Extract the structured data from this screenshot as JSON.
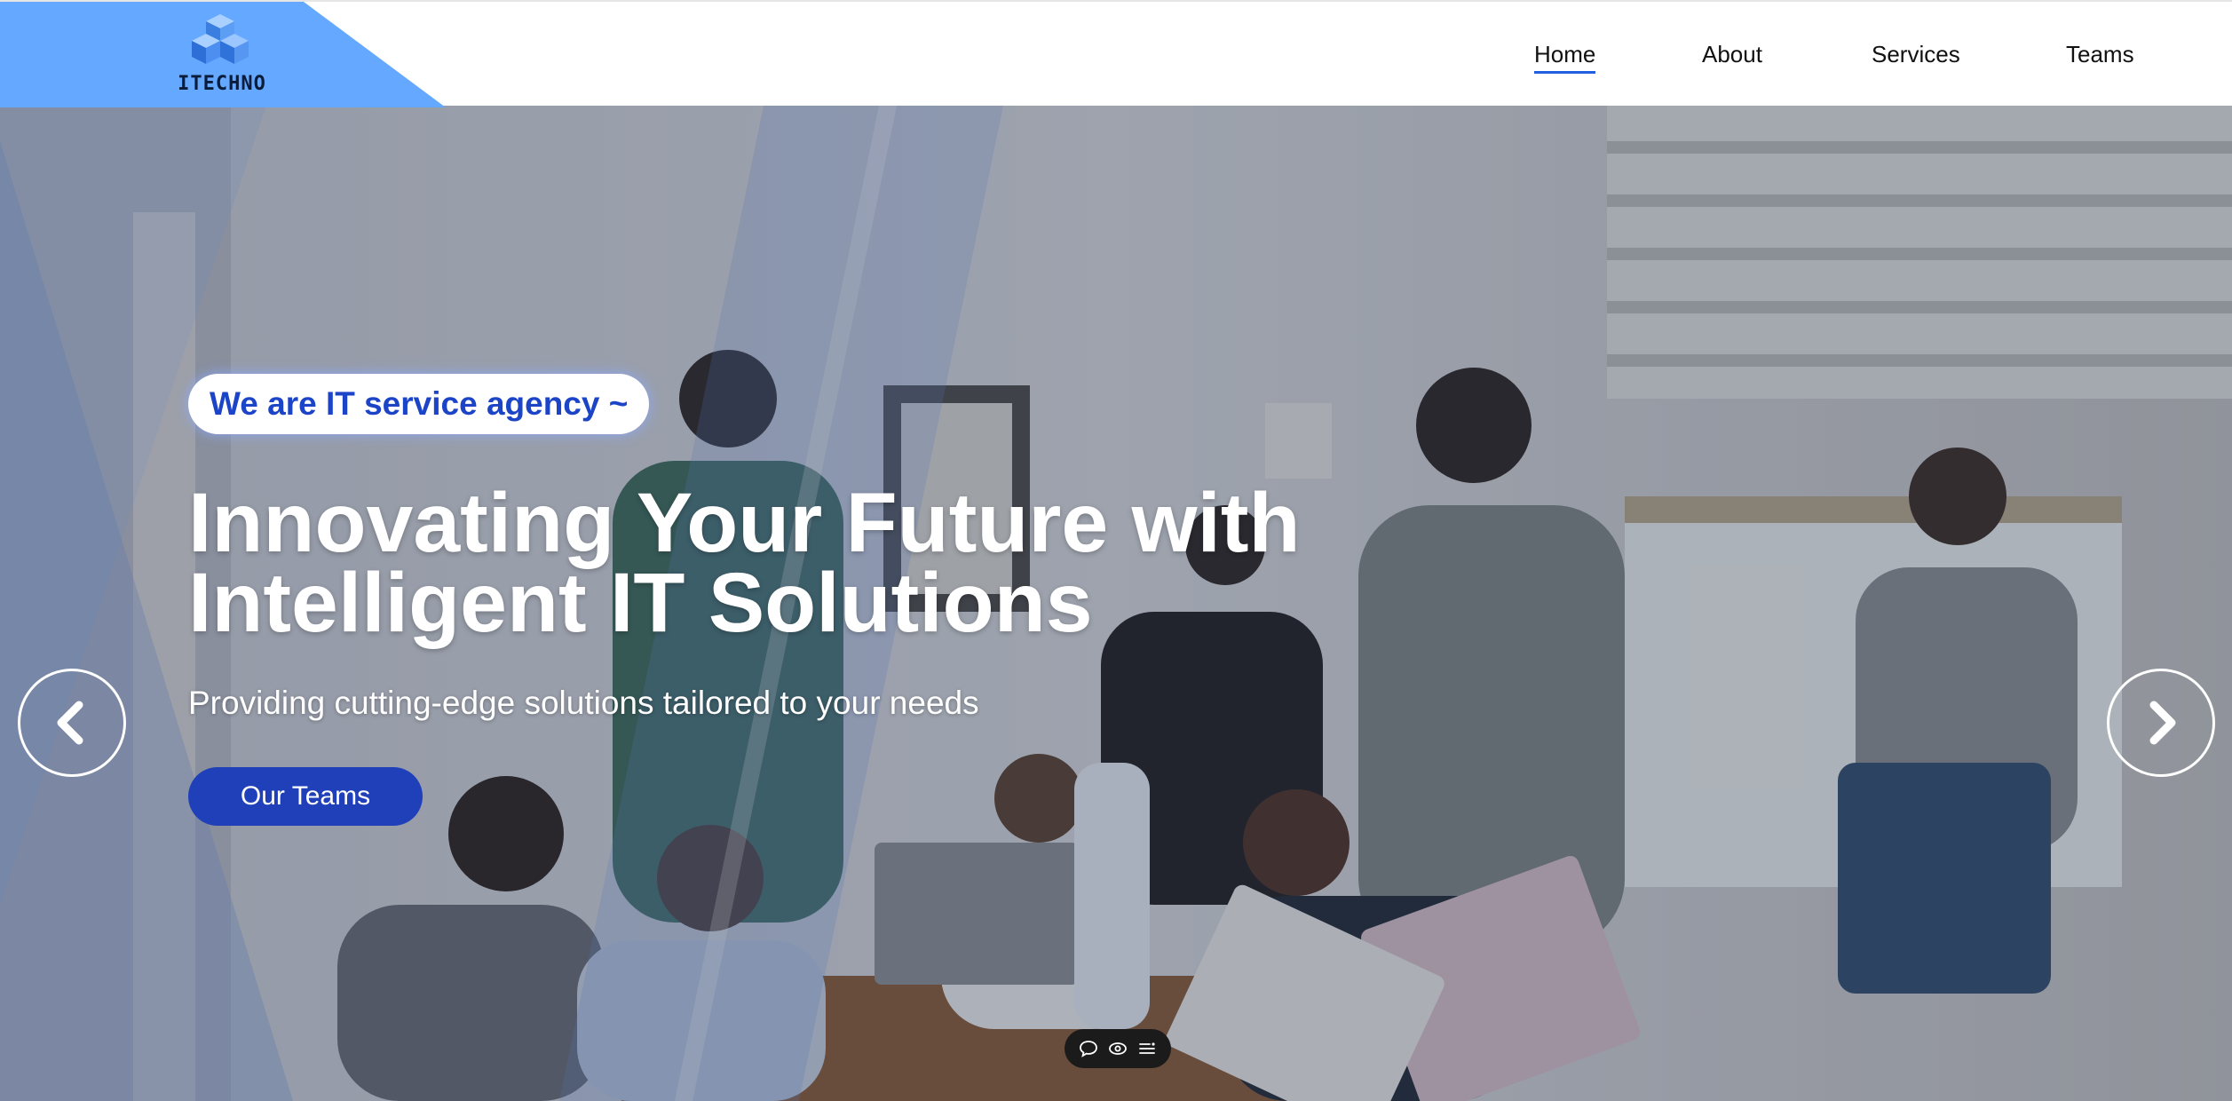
{
  "brand": {
    "logo_text": "ITECHNO",
    "accent_color": "#64a8ff",
    "primary_color": "#1f40b8"
  },
  "nav": {
    "items": [
      {
        "label": "Home",
        "active": true
      },
      {
        "label": "About",
        "active": false
      },
      {
        "label": "Services",
        "active": false
      },
      {
        "label": "Teams",
        "active": false
      }
    ]
  },
  "hero": {
    "tagline": "We are IT service agency ~",
    "headline_line1": "Innovating Your Future with",
    "headline_line2": "Intelligent IT Solutions",
    "subheadline": "Providing cutting-edge solutions tailored to your needs",
    "cta_label": "Our Teams",
    "prev_icon": "chevron-left-icon",
    "next_icon": "chevron-right-icon"
  },
  "floating_toolbar": {
    "icons": [
      "comment-icon",
      "eye-icon",
      "menu-icon"
    ]
  }
}
